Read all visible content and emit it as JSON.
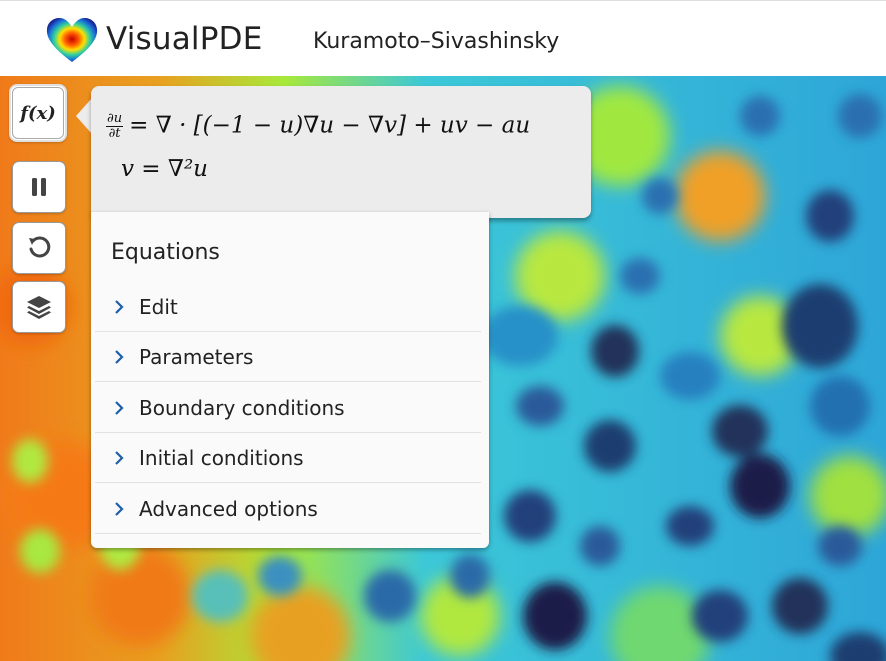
{
  "header": {
    "app_name": "VisualPDE",
    "page_title": "Kuramoto–Sivashinsky"
  },
  "toolbar": {
    "equations_button": "f(x)",
    "pause_icon": "pause-icon",
    "reset_icon": "reset-icon",
    "layers_icon": "layers-icon"
  },
  "equations": {
    "line1_lhs_num": "∂u",
    "line1_lhs_den": "∂t",
    "line1_rhs": "= ∇ · [(−1 − u)∇u − ∇v] + uv − au",
    "line2": "v = ∇²u"
  },
  "menu": {
    "title": "Equations",
    "items": [
      {
        "label": "Edit"
      },
      {
        "label": "Parameters"
      },
      {
        "label": "Boundary conditions"
      },
      {
        "label": "Initial conditions"
      },
      {
        "label": "Advanced options"
      }
    ]
  },
  "colors": {
    "chevron": "#1f5fa8",
    "panel_bg": "#ececec",
    "menu_bg": "#fafafa"
  }
}
